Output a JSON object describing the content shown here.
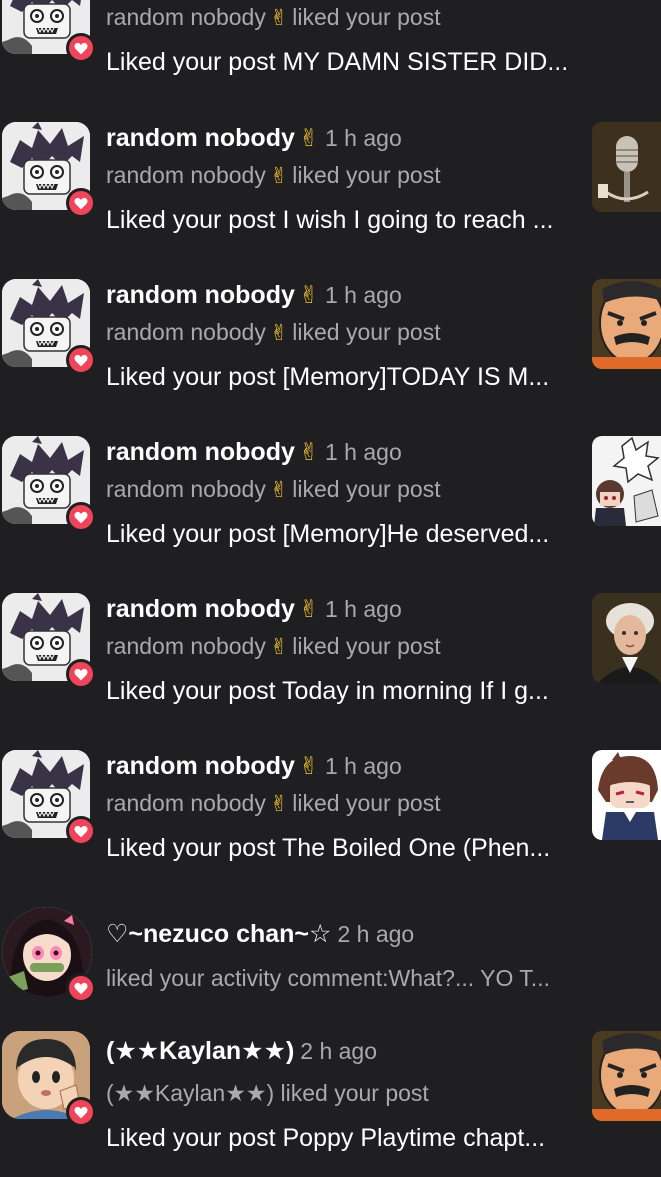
{
  "notifications": [
    {
      "id": "n0",
      "name": "",
      "time": "",
      "sub_prefix": "random nobody",
      "sub_suffix": "liked your post",
      "message": "Liked your post MY DAMN SISTER DID...",
      "thumb_icon": ""
    },
    {
      "id": "n1",
      "name": "random nobody",
      "time": "1 h ago",
      "sub_prefix": "random nobody",
      "sub_suffix": "liked your post",
      "message": "Liked your post I wish I going to reach ...",
      "thumb_icon": "microphone-thumbnail"
    },
    {
      "id": "n2",
      "name": "random nobody",
      "time": "1 h ago",
      "sub_prefix": "random nobody",
      "sub_suffix": "liked your post",
      "message": "Liked your post [Memory]TODAY IS M...",
      "thumb_icon": "angry-man-thumbnail"
    },
    {
      "id": "n3",
      "name": "random nobody",
      "time": "1 h ago",
      "sub_prefix": "random nobody",
      "sub_suffix": "liked your post",
      "message": "Liked your post [Memory]He deserved...",
      "thumb_icon": "sketch-characters-thumbnail"
    },
    {
      "id": "n4",
      "name": "random nobody",
      "time": "1 h ago",
      "sub_prefix": "random nobody",
      "sub_suffix": "liked your post",
      "message": "Liked your post Today in morning If I g...",
      "thumb_icon": "portrait-painting-thumbnail"
    },
    {
      "id": "n5",
      "name": "random nobody",
      "time": "1 h ago",
      "sub_prefix": "random nobody",
      "sub_suffix": "liked your post",
      "message": "Liked your post The Boiled One (Phen...",
      "thumb_icon": "anime-girl-thumbnail"
    },
    {
      "id": "n6",
      "name": "♡~nezuco chan~☆",
      "time": "2 h ago",
      "sub_text": "liked your activity comment:What?... YO T...",
      "avatar_icon": "nezuko-avatar"
    },
    {
      "id": "n7",
      "name": "(★★Kaylan★★)",
      "time": "2 h ago",
      "sub_text": "(★★Kaylan★★) liked your post",
      "message": "Liked your post Poppy Playtime chapt...",
      "avatar_icon": "kaylan-avatar",
      "thumb_icon": "angry-man-thumbnail"
    }
  ],
  "emoji": {
    "victory_hand": "✌"
  },
  "colors": {
    "background": "#1f1f22",
    "badge": "#f0445a",
    "muted_text": "#a9a9ae",
    "primary_text": "#ffffff"
  }
}
